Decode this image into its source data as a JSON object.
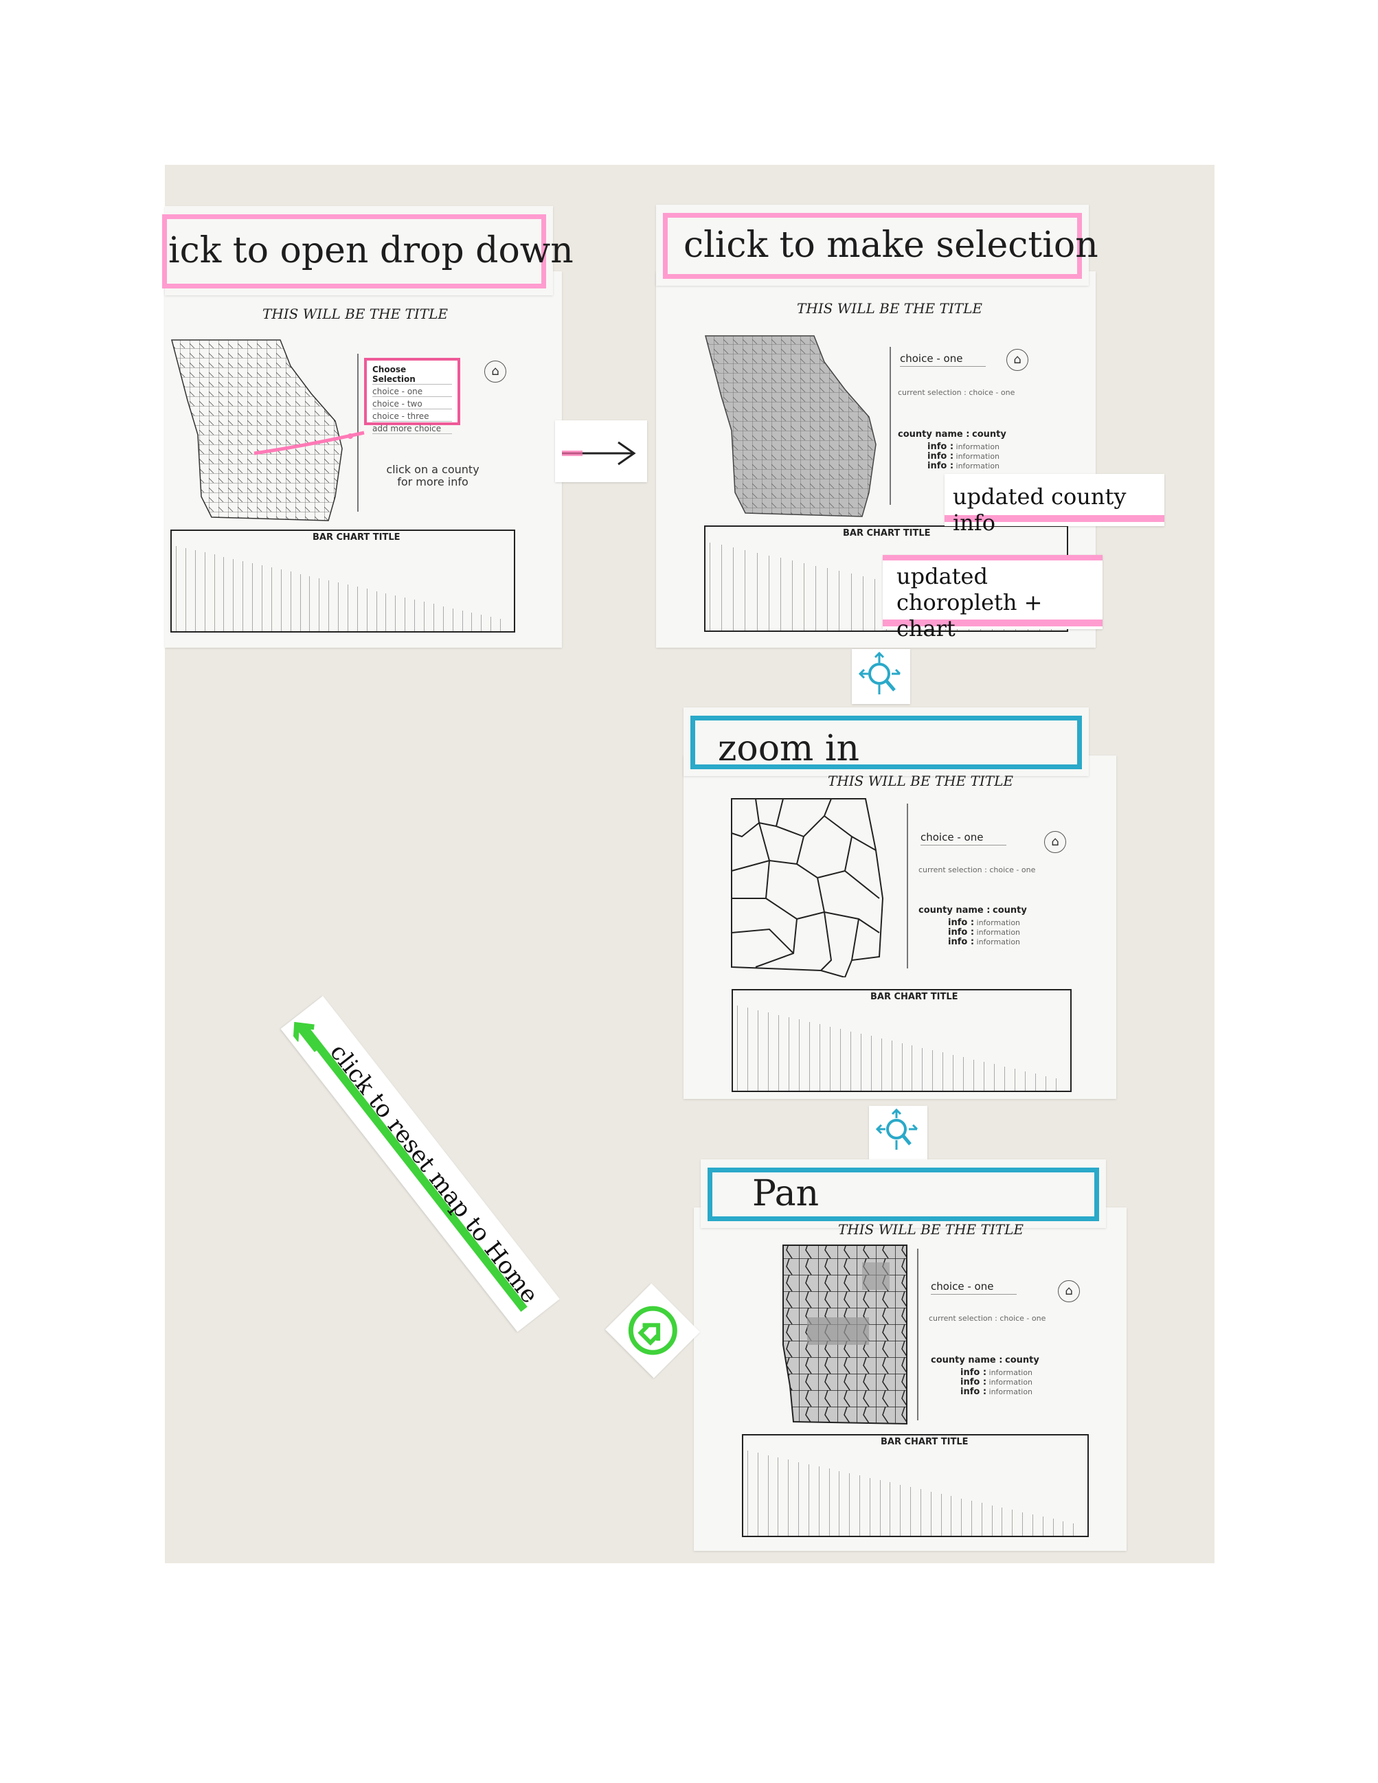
{
  "panels": [
    {
      "step_label": "ick to open drop down",
      "title": "THIS WILL BE THE TITLE",
      "dropdown_options": [
        "Choose Selection",
        "choice - one",
        "choice - two",
        "choice - three",
        "add more choice"
      ],
      "hint": "click on a county for more info",
      "bar_chart_title": "BAR CHART TITLE"
    },
    {
      "step_label": "click to make selection",
      "title": "THIS WILL BE THE TITLE",
      "dropdown_value": "choice - one",
      "current_selection": "current selection : choice - one",
      "county_name_label": "county name :",
      "county_name_value": "county",
      "info_rows": [
        {
          "key": "info :",
          "value": "information"
        },
        {
          "key": "info :",
          "value": "information"
        },
        {
          "key": "info :",
          "value": "information"
        }
      ],
      "bar_chart_title": "BAR CHART TITLE"
    },
    {
      "step_label": "zoom in",
      "title": "THIS WILL BE THE TITLE",
      "dropdown_value": "choice - one",
      "current_selection": "current selection : choice - one",
      "county_name_label": "county name :",
      "county_name_value": "county",
      "info_rows": [
        {
          "key": "info :",
          "value": "information"
        },
        {
          "key": "info :",
          "value": "information"
        },
        {
          "key": "info :",
          "value": "information"
        }
      ],
      "bar_chart_title": "BAR CHART TITLE"
    },
    {
      "step_label": "Pan",
      "title": "THIS WILL BE THE TITLE",
      "dropdown_value": "choice - one",
      "current_selection": "current selection : choice - one",
      "county_name_label": "county name :",
      "county_name_value": "county",
      "info_rows": [
        {
          "key": "info :",
          "value": "information"
        },
        {
          "key": "info :",
          "value": "information"
        },
        {
          "key": "info :",
          "value": "information"
        }
      ],
      "bar_chart_title": "BAR CHART TITLE"
    }
  ],
  "notes": {
    "updated_county_info": "updated county info",
    "updated_choropleth_chart": [
      "updated",
      "choropleth + chart"
    ],
    "reset_home": "click to reset map to Home"
  },
  "colors": {
    "pink": "#ff9ccf",
    "blue": "#2aa9c9",
    "green": "#3fd23a",
    "wall": "#ece9e2"
  },
  "icons": [
    "home-icon",
    "zoom-pan-icon",
    "arrow-right-icon"
  ]
}
